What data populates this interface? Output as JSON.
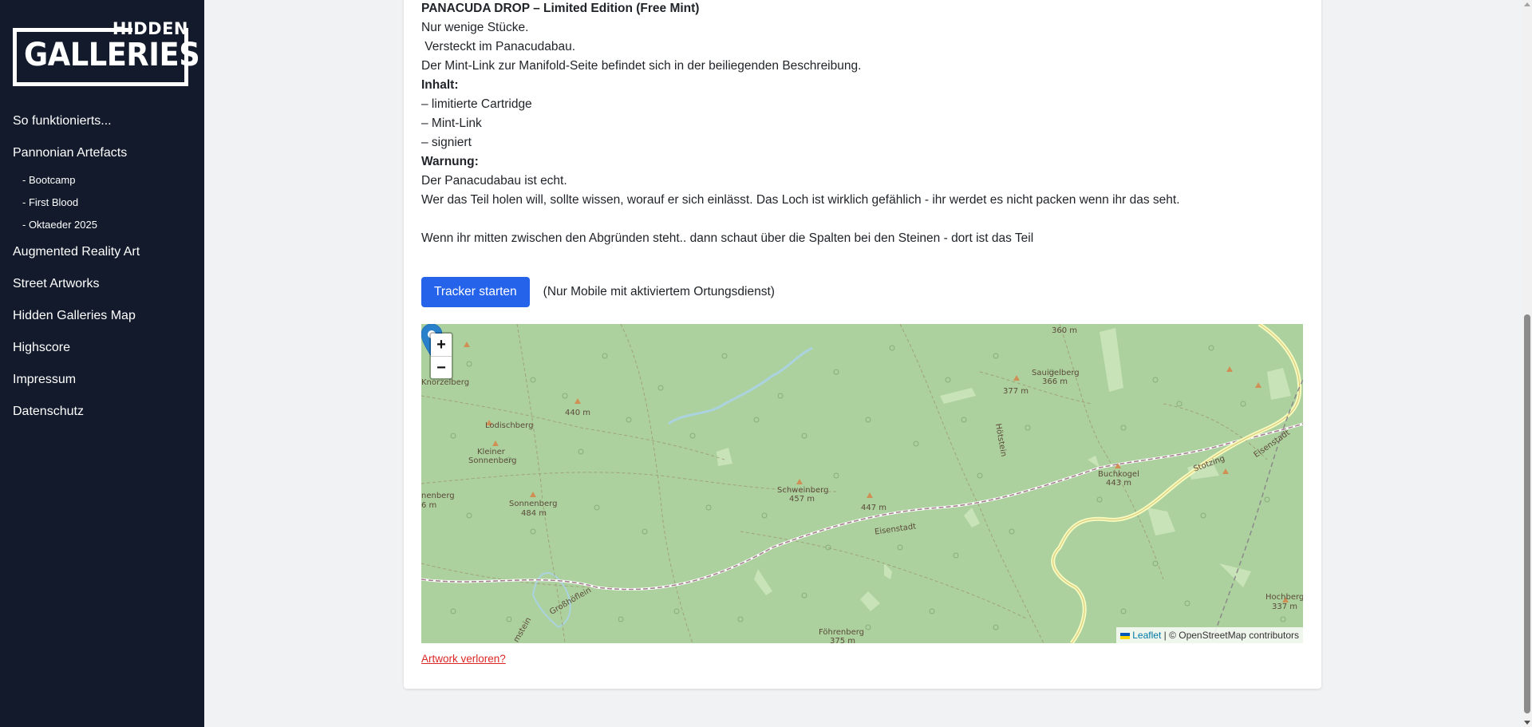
{
  "sidebar": {
    "logo": {
      "top_text": "HIDDEN",
      "main_text": "GALLERIES"
    },
    "items": [
      {
        "label": "So funktionierts..."
      },
      {
        "label": "Pannonian Artefacts"
      },
      {
        "label": "- Bootcamp"
      },
      {
        "label": "- First Blood"
      },
      {
        "label": "- Oktaeder 2025"
      },
      {
        "label": "Augmented Reality Art"
      },
      {
        "label": "Street Artworks"
      },
      {
        "label": "Hidden Galleries Map"
      },
      {
        "label": "Highscore"
      },
      {
        "label": "Impressum"
      },
      {
        "label": "Datenschutz"
      }
    ]
  },
  "article": {
    "lines": [
      "PANACUDA DROP – Limited Edition (Free Mint)",
      "Nur wenige Stücke.",
      " Versteckt im Panacudabau.",
      "Der Mint-Link zur Manifold-Seite befindet sich in der beiliegenden Beschreibung.",
      "Inhalt:",
      "– limitierte Cartridge",
      "– Mint-Link",
      "– signiert",
      "Warnung:",
      "Der Panacudabau ist echt.",
      "Wer das Teil holen will, sollte wissen, worauf er sich einlässt. Das Loch ist wirklich gefählich - ihr werdet es nicht packen wenn ihr das seht.",
      "Wenn ihr mitten zwischen den Abgründen steht.. dann schaut über die Spalten bei den Steinen - dort ist das Teil"
    ]
  },
  "tracker": {
    "button_label": "Tracker starten",
    "note": "(Nur Mobile mit aktiviertem Ortungsdienst)"
  },
  "map": {
    "zoom_in": "+",
    "zoom_out": "−",
    "attribution_leaflet": "Leaflet",
    "attribution_rest": " | © OpenStreetMap contributors",
    "labels": {
      "l360": "360 m",
      "l377": "377 m",
      "sauigelberg": "Sauigelberg",
      "l366": "366 m",
      "knorzelberg": "Knorzelberg",
      "l440": "440 m",
      "lodischberg": "Lodischberg",
      "kleiner": "Kleiner",
      "sonnenberg_a": "Sonnenberg",
      "hotstein": "Hötstein",
      "buchkogel": "Buchkogel",
      "l443": "443 m",
      "stotzing": "Stotzing",
      "eisenstadt_a": "Eisenstadt",
      "schweinberg": "Schweinberg",
      "l457": "457 m",
      "l447": "447 m",
      "nenberg": "nenberg",
      "l6m": "6 m",
      "sonnenberg_b": "Sonnenberg",
      "l484": "484 m",
      "eisenstadt_b": "Eisenstadt",
      "grosshoflein": "Großhöflein",
      "hochberg": "Hochberg",
      "l337": "337 m",
      "fohrenberg": "Föhrenberg",
      "l375": "375 m",
      "mstein": "mstein"
    }
  },
  "footer_link": "Artwork verloren?",
  "colors": {
    "sidebar_bg": "#121a2b",
    "button_primary": "#2563eb",
    "link_danger": "#dc2626",
    "map_forest": "#add19e",
    "marker": "#2a81cb"
  }
}
